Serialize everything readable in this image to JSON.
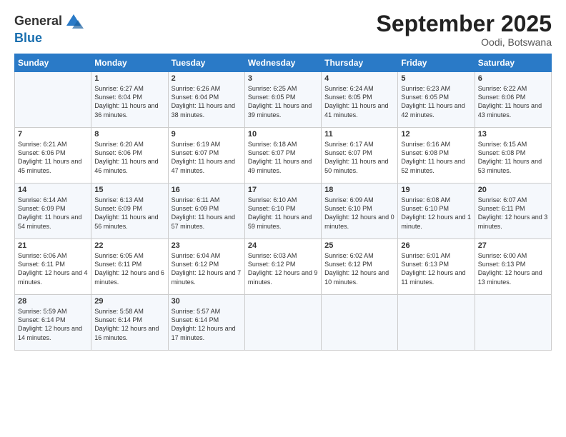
{
  "header": {
    "logo_line1": "General",
    "logo_line2": "Blue",
    "month": "September 2025",
    "location": "Oodi, Botswana"
  },
  "weekdays": [
    "Sunday",
    "Monday",
    "Tuesday",
    "Wednesday",
    "Thursday",
    "Friday",
    "Saturday"
  ],
  "weeks": [
    [
      {
        "day": "",
        "sunrise": "",
        "sunset": "",
        "daylight": ""
      },
      {
        "day": "1",
        "sunrise": "6:27 AM",
        "sunset": "6:04 PM",
        "daylight": "11 hours and 36 minutes."
      },
      {
        "day": "2",
        "sunrise": "6:26 AM",
        "sunset": "6:04 PM",
        "daylight": "11 hours and 38 minutes."
      },
      {
        "day": "3",
        "sunrise": "6:25 AM",
        "sunset": "6:05 PM",
        "daylight": "11 hours and 39 minutes."
      },
      {
        "day": "4",
        "sunrise": "6:24 AM",
        "sunset": "6:05 PM",
        "daylight": "11 hours and 41 minutes."
      },
      {
        "day": "5",
        "sunrise": "6:23 AM",
        "sunset": "6:05 PM",
        "daylight": "11 hours and 42 minutes."
      },
      {
        "day": "6",
        "sunrise": "6:22 AM",
        "sunset": "6:06 PM",
        "daylight": "11 hours and 43 minutes."
      }
    ],
    [
      {
        "day": "7",
        "sunrise": "6:21 AM",
        "sunset": "6:06 PM",
        "daylight": "11 hours and 45 minutes."
      },
      {
        "day": "8",
        "sunrise": "6:20 AM",
        "sunset": "6:06 PM",
        "daylight": "11 hours and 46 minutes."
      },
      {
        "day": "9",
        "sunrise": "6:19 AM",
        "sunset": "6:07 PM",
        "daylight": "11 hours and 47 minutes."
      },
      {
        "day": "10",
        "sunrise": "6:18 AM",
        "sunset": "6:07 PM",
        "daylight": "11 hours and 49 minutes."
      },
      {
        "day": "11",
        "sunrise": "6:17 AM",
        "sunset": "6:07 PM",
        "daylight": "11 hours and 50 minutes."
      },
      {
        "day": "12",
        "sunrise": "6:16 AM",
        "sunset": "6:08 PM",
        "daylight": "11 hours and 52 minutes."
      },
      {
        "day": "13",
        "sunrise": "6:15 AM",
        "sunset": "6:08 PM",
        "daylight": "11 hours and 53 minutes."
      }
    ],
    [
      {
        "day": "14",
        "sunrise": "6:14 AM",
        "sunset": "6:09 PM",
        "daylight": "11 hours and 54 minutes."
      },
      {
        "day": "15",
        "sunrise": "6:13 AM",
        "sunset": "6:09 PM",
        "daylight": "11 hours and 56 minutes."
      },
      {
        "day": "16",
        "sunrise": "6:11 AM",
        "sunset": "6:09 PM",
        "daylight": "11 hours and 57 minutes."
      },
      {
        "day": "17",
        "sunrise": "6:10 AM",
        "sunset": "6:10 PM",
        "daylight": "11 hours and 59 minutes."
      },
      {
        "day": "18",
        "sunrise": "6:09 AM",
        "sunset": "6:10 PM",
        "daylight": "12 hours and 0 minutes."
      },
      {
        "day": "19",
        "sunrise": "6:08 AM",
        "sunset": "6:10 PM",
        "daylight": "12 hours and 1 minute."
      },
      {
        "day": "20",
        "sunrise": "6:07 AM",
        "sunset": "6:11 PM",
        "daylight": "12 hours and 3 minutes."
      }
    ],
    [
      {
        "day": "21",
        "sunrise": "6:06 AM",
        "sunset": "6:11 PM",
        "daylight": "12 hours and 4 minutes."
      },
      {
        "day": "22",
        "sunrise": "6:05 AM",
        "sunset": "6:11 PM",
        "daylight": "12 hours and 6 minutes."
      },
      {
        "day": "23",
        "sunrise": "6:04 AM",
        "sunset": "6:12 PM",
        "daylight": "12 hours and 7 minutes."
      },
      {
        "day": "24",
        "sunrise": "6:03 AM",
        "sunset": "6:12 PM",
        "daylight": "12 hours and 9 minutes."
      },
      {
        "day": "25",
        "sunrise": "6:02 AM",
        "sunset": "6:12 PM",
        "daylight": "12 hours and 10 minutes."
      },
      {
        "day": "26",
        "sunrise": "6:01 AM",
        "sunset": "6:13 PM",
        "daylight": "12 hours and 11 minutes."
      },
      {
        "day": "27",
        "sunrise": "6:00 AM",
        "sunset": "6:13 PM",
        "daylight": "12 hours and 13 minutes."
      }
    ],
    [
      {
        "day": "28",
        "sunrise": "5:59 AM",
        "sunset": "6:14 PM",
        "daylight": "12 hours and 14 minutes."
      },
      {
        "day": "29",
        "sunrise": "5:58 AM",
        "sunset": "6:14 PM",
        "daylight": "12 hours and 16 minutes."
      },
      {
        "day": "30",
        "sunrise": "5:57 AM",
        "sunset": "6:14 PM",
        "daylight": "12 hours and 17 minutes."
      },
      {
        "day": "",
        "sunrise": "",
        "sunset": "",
        "daylight": ""
      },
      {
        "day": "",
        "sunrise": "",
        "sunset": "",
        "daylight": ""
      },
      {
        "day": "",
        "sunrise": "",
        "sunset": "",
        "daylight": ""
      },
      {
        "day": "",
        "sunrise": "",
        "sunset": "",
        "daylight": ""
      }
    ]
  ],
  "labels": {
    "sunrise_prefix": "Sunrise: ",
    "sunset_prefix": "Sunset: ",
    "daylight_prefix": "Daylight: "
  }
}
